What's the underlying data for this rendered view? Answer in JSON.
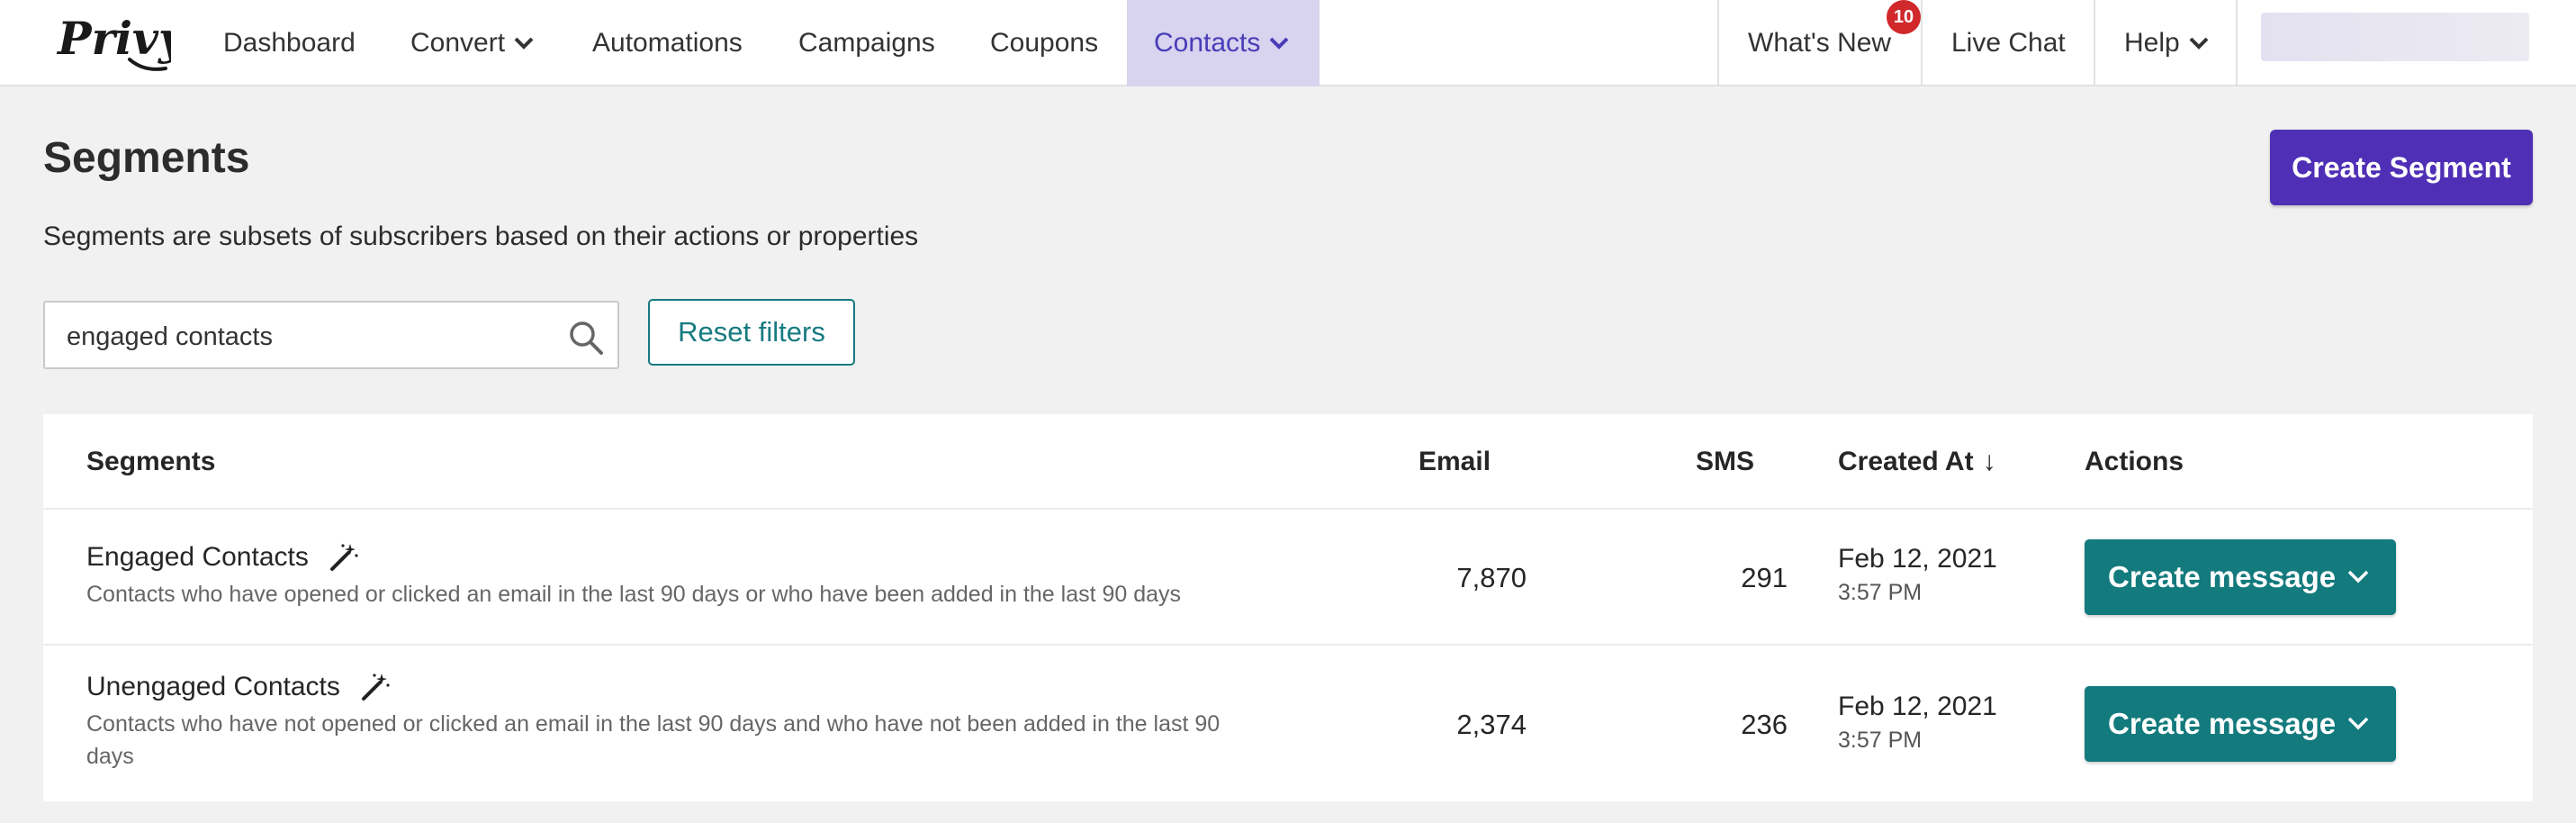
{
  "nav": {
    "logo_text": "Privy",
    "items": [
      {
        "label": "Dashboard"
      },
      {
        "label": "Convert"
      },
      {
        "label": "Automations"
      },
      {
        "label": "Campaigns"
      },
      {
        "label": "Coupons"
      },
      {
        "label": "Contacts"
      }
    ],
    "whats_new": "What's New",
    "whats_new_badge": "10",
    "live_chat": "Live Chat",
    "help": "Help",
    "active_color": "#d8d3ee"
  },
  "page": {
    "title": "Segments",
    "subtitle": "Segments are subsets of subscribers based on their actions or properties",
    "create_button": "Create Segment"
  },
  "filters": {
    "search_value": "engaged contacts",
    "reset_label": "Reset filters"
  },
  "table": {
    "columns": {
      "segments": "Segments",
      "email": "Email",
      "sms": "SMS",
      "created_at": "Created At",
      "created_at_sort": "↓",
      "actions": "Actions"
    },
    "rows": [
      {
        "name": "Engaged Contacts",
        "description": "Contacts who have opened or clicked an email in the last 90 days or who have been added in the last 90 days",
        "email": "7,870",
        "sms": "291",
        "date": "Feb 12, 2021",
        "time": "3:57 PM",
        "action": "Create message"
      },
      {
        "name": "Unengaged Contacts",
        "description": "Contacts who have not opened or clicked an email in the last 90 days and who have not been added in the last 90 days",
        "email": "2,374",
        "sms": "236",
        "date": "Feb 12, 2021",
        "time": "3:57 PM",
        "action": "Create message"
      }
    ]
  },
  "colors": {
    "brand_purple": "#4f2fb6",
    "teal": "#137a7d",
    "badge_red": "#d0282b"
  }
}
